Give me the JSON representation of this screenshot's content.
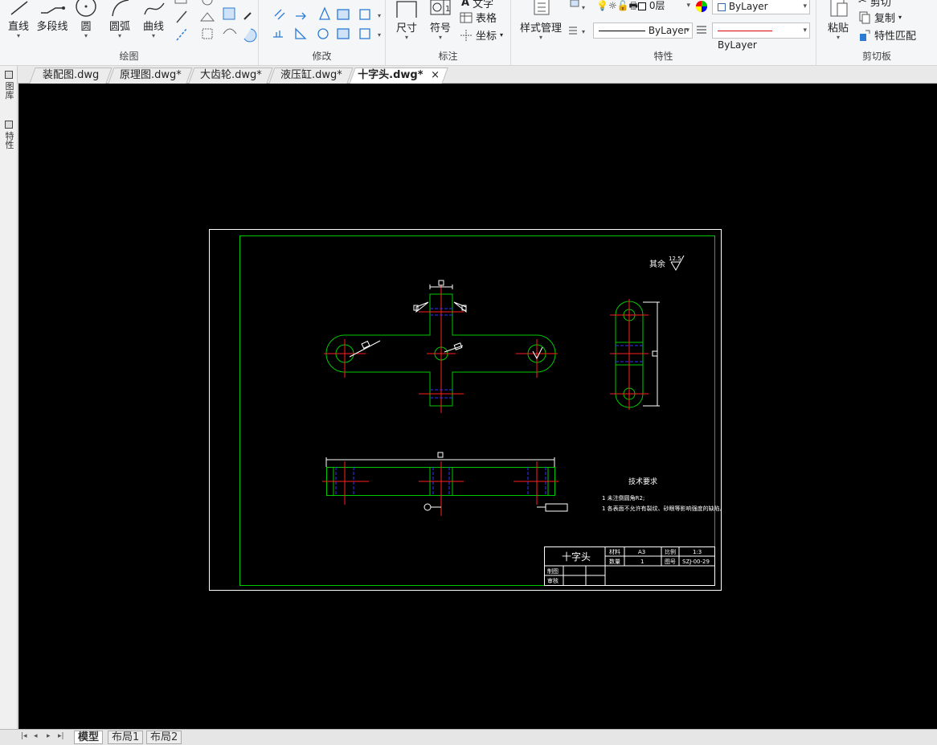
{
  "ribbon": {
    "draw_panel": {
      "title": "绘图",
      "tools": [
        "直线",
        "多段线",
        "圆",
        "圆弧",
        "曲线"
      ]
    },
    "modify_panel": {
      "title": "修改"
    },
    "annotate_panel": {
      "title": "标注",
      "dimension": "尺寸",
      "symbol": "符号",
      "text": "文字",
      "table": "表格",
      "coordinate": "坐标"
    },
    "properties_panel": {
      "title": "特性",
      "style_manager": "样式管理",
      "layer_value": "0层",
      "color_value": "ByLayer",
      "linetype_value": "ByLayer",
      "lineweight_value": "ByLayer"
    },
    "clipboard_panel": {
      "title": "剪切板",
      "paste": "粘贴",
      "cut": "剪切",
      "copy": "复制",
      "match_properties": "特性匹配"
    }
  },
  "tabs": [
    {
      "label": "装配图.dwg"
    },
    {
      "label": "原理图.dwg*"
    },
    {
      "label": "大齿轮.dwg*"
    },
    {
      "label": "液压缸.dwg*"
    },
    {
      "label": "十字头.dwg*",
      "active": true
    }
  ],
  "tab_close": "×",
  "sidebar": {
    "tab1": "图库",
    "tab2": "特性"
  },
  "drawing": {
    "surface_note": "其余",
    "surface_value": "12.5",
    "tech_title": "技术要求",
    "tech_line1": "1 未注倒圆角R2;",
    "tech_line2": "1 各表面不允许有裂纹、砂眼等影响强度的缺陷。",
    "title_name": "十字头",
    "label_material": "材料",
    "value_material": "A3",
    "label_scale": "比例",
    "value_scale": "1:3",
    "label_qty": "数量",
    "value_qty": "1",
    "label_drawing_no": "图号",
    "value_drawing_no": "SZJ-00-29",
    "label_drawn": "制图",
    "label_checked": "审核"
  },
  "layout_tabs": {
    "model": "模型",
    "layout1": "布局1",
    "layout2": "布局2"
  },
  "colors": {
    "canvas": "#000000",
    "frame": "#ffffff",
    "part": "#00c800",
    "center": "#ff2020",
    "hidden": "#3232ff",
    "annot": "#ffffff"
  }
}
